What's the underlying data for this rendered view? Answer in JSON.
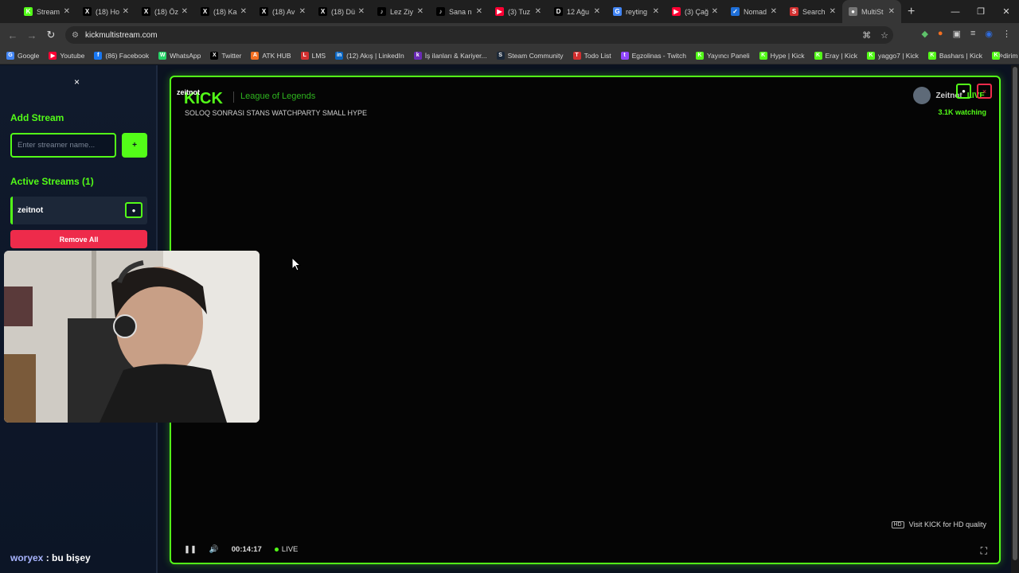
{
  "browser": {
    "tabs": [
      {
        "label": "Stream",
        "fav": "K",
        "color": "#53fc18"
      },
      {
        "label": "(18) Ho",
        "fav": "X",
        "color": "#000000"
      },
      {
        "label": "(18) Öz",
        "fav": "X",
        "color": "#000000"
      },
      {
        "label": "(18) Ka",
        "fav": "X",
        "color": "#000000"
      },
      {
        "label": "(18) Av",
        "fav": "X",
        "color": "#000000"
      },
      {
        "label": "(18) Dü",
        "fav": "X",
        "color": "#000000"
      },
      {
        "label": "Lez Ziy",
        "fav": "♪",
        "color": "#000000"
      },
      {
        "label": "Sana n",
        "fav": "♪",
        "color": "#000000"
      },
      {
        "label": "(3) Tuz",
        "fav": "▶",
        "color": "#ff0033"
      },
      {
        "label": "12 Ağu",
        "fav": "D",
        "color": "#000000"
      },
      {
        "label": "reyting",
        "fav": "G",
        "color": "#4285f4"
      },
      {
        "label": "(3) Çağ",
        "fav": "▶",
        "color": "#ff0033"
      },
      {
        "label": "Nomad",
        "fav": "✓",
        "color": "#1e6fd9"
      },
      {
        "label": "Search",
        "fav": "S",
        "color": "#d32f2f"
      },
      {
        "label": "MultiSt",
        "fav": "●",
        "color": "#777777",
        "active": true
      }
    ],
    "new_tab": "+",
    "url": "kickmultistream.com",
    "bookmarks": [
      {
        "label": "Google",
        "fav": "G",
        "color": "#4285f4"
      },
      {
        "label": "Youtube",
        "fav": "▶",
        "color": "#ff0033"
      },
      {
        "label": "(86) Facebook",
        "fav": "f",
        "color": "#1877f2"
      },
      {
        "label": "WhatsApp",
        "fav": "W",
        "color": "#25d366"
      },
      {
        "label": "Twitter",
        "fav": "X",
        "color": "#000000"
      },
      {
        "label": "ATK HUB",
        "fav": "A",
        "color": "#f36f21"
      },
      {
        "label": "LMS",
        "fav": "L",
        "color": "#d32f2f"
      },
      {
        "label": "(12) Akış | LinkedIn",
        "fav": "in",
        "color": "#0a66c2"
      },
      {
        "label": "İş ilanları & Kariyer...",
        "fav": "k",
        "color": "#6b2bb6"
      },
      {
        "label": "Steam Community",
        "fav": "S",
        "color": "#1b2838"
      },
      {
        "label": "Todo List",
        "fav": "T",
        "color": "#d32f2f"
      },
      {
        "label": "Egzolinas - Twitch",
        "fav": "t",
        "color": "#9146ff"
      },
      {
        "label": "Yayıncı Paneli",
        "fav": "K",
        "color": "#53fc18"
      },
      {
        "label": "Hype | Kick",
        "fav": "K",
        "color": "#53fc18"
      },
      {
        "label": "Eray | Kick",
        "fav": "K",
        "color": "#53fc18"
      },
      {
        "label": "yaggo7 | Kick",
        "fav": "K",
        "color": "#53fc18"
      },
      {
        "label": "Bashars | Kick",
        "fav": "K",
        "color": "#53fc18"
      },
      {
        "label": "dirim | Kick",
        "fav": "K",
        "color": "#53fc18"
      }
    ]
  },
  "sidebar": {
    "close": "×",
    "add_title": "Add Stream",
    "input_placeholder": "Enter streamer name...",
    "add_button": "+",
    "active_title": "Active Streams (1)",
    "streams": [
      {
        "name": "zeitnot"
      }
    ],
    "remove_all": "Remove All"
  },
  "chat": {
    "user": "woryex",
    "message": " : bu bişey"
  },
  "player": {
    "name_label": "zeitnot",
    "logo": "KICK",
    "game": "League of Legends",
    "stream_title": "SOLOQ SONRASI STANS WATCHPARTY SMALL HYPE",
    "streamer": "Zeitnot",
    "live_tag": "LIVE",
    "watching": "3.1K watching",
    "hd_note": "Visit KICK for HD quality",
    "hd_badge": "HD",
    "time": "00:14:17",
    "live": "LIVE"
  },
  "colors": {
    "accent": "#53fc18",
    "danger": "#ee2b4b",
    "bg": "#0b1220"
  }
}
